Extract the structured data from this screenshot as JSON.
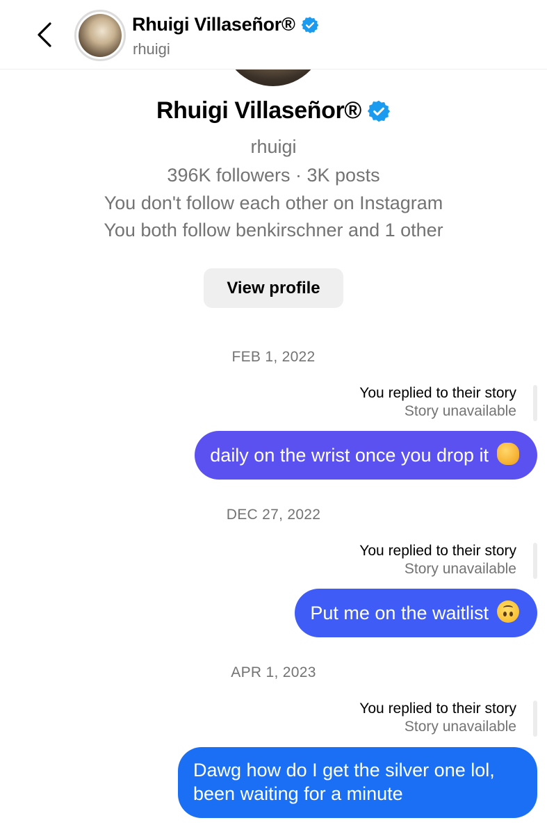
{
  "header": {
    "name": "Rhuigi Villaseñor®",
    "handle": "rhuigi"
  },
  "profile": {
    "name": "Rhuigi Villaseñor®",
    "handle": "rhuigi",
    "stats": "396K followers · 3K posts",
    "follow_status": "You don't follow each other on Instagram",
    "mutuals": "You both follow benkirschner and 1 other",
    "view_profile_label": "View profile"
  },
  "messages": [
    {
      "date": "FEB 1, 2022",
      "reply_title": "You replied to their story",
      "reply_sub": "Story unavailable",
      "text": "daily on the wrist once you drop it",
      "emoji": "oncoming-fist",
      "color": "#5b51f0"
    },
    {
      "date": "DEC 27, 2022",
      "reply_title": "You replied to their story",
      "reply_sub": "Story unavailable",
      "text": "Put me on the waitlist",
      "emoji": "upside-down-face",
      "color": "#3f5cf7"
    },
    {
      "date": "APR 1, 2023",
      "reply_title": "You replied to their story",
      "reply_sub": "Story unavailable",
      "text_line1": "Dawg how do I get the silver one lol,",
      "text_line2": "been waiting for a minute",
      "color": "#1a6ff5"
    }
  ],
  "colors": {
    "verified": "#1a9bf0",
    "secondary_text": "#737373"
  }
}
